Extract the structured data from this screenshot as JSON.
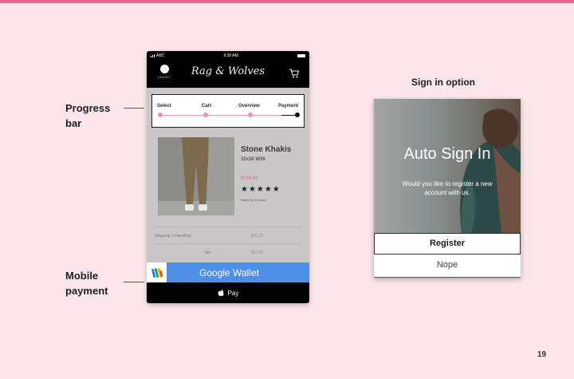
{
  "callouts": {
    "progress_bar": [
      "Progress",
      "bar"
    ],
    "mobile_payment": [
      "Mobile",
      "payment"
    ]
  },
  "phone": {
    "status": {
      "carrier": "ABC",
      "time": "9:30 AM"
    },
    "header": {
      "account_label": "LINDSEY",
      "brand": "Rag & Wolves"
    },
    "progress": {
      "steps": [
        "Select",
        "Cart",
        "Overview",
        "Payment"
      ],
      "colors": {
        "done": "#e895a6",
        "current": "#111111"
      }
    },
    "product": {
      "name": "Stone Khakis",
      "size": "32x30 W36",
      "price": "$130.00",
      "rating_stars": "★★★★★",
      "reviews": "Rated by 60 users"
    },
    "summary": [
      {
        "label": "Shipping + Handling:",
        "value": "$11.22"
      },
      {
        "label": "Tax:",
        "value": "$10.30"
      }
    ],
    "payments": {
      "google_wallet": "Google Wallet",
      "apple_pay": "Pay"
    }
  },
  "signin": {
    "section_title": "Sign in option",
    "heading": "Auto Sign In",
    "message": "Would you like to register a new account with us.",
    "register": "Register",
    "nope": "Nope"
  },
  "page_number": "19"
}
